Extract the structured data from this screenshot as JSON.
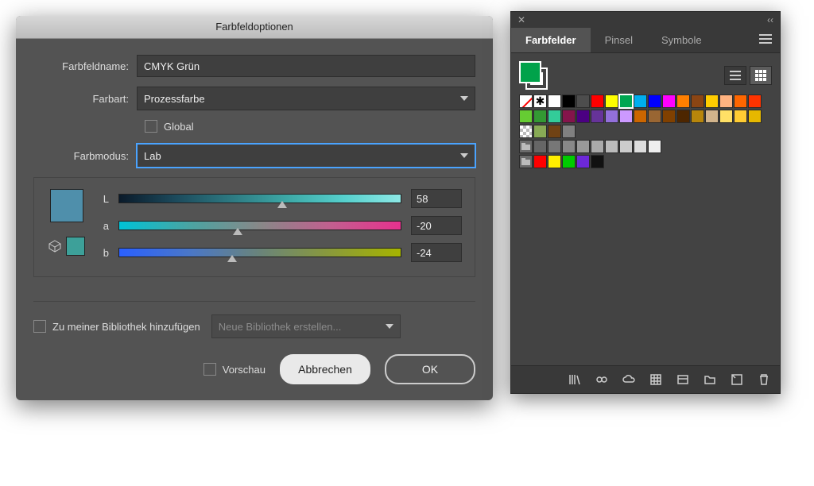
{
  "dialog": {
    "title": "Farbfeldoptionen",
    "name_label": "Farbfeldname:",
    "name_value": "CMYK Grün",
    "type_label": "Farbart:",
    "type_value": "Prozessfarbe",
    "global_label": "Global",
    "mode_label": "Farbmodus:",
    "mode_value": "Lab",
    "channels": {
      "L": {
        "label": "L",
        "value": "58",
        "thumb_pct": 58
      },
      "a": {
        "label": "a",
        "value": "-20",
        "thumb_pct": 42
      },
      "b": {
        "label": "b",
        "value": "-24",
        "thumb_pct": 40
      }
    },
    "preview_main_color": "#4f8fab",
    "preview_orig_color": "#3da099",
    "add_to_lib_label": "Zu meiner Bibliothek hinzufügen",
    "lib_select_placeholder": "Neue Bibliothek erstellen...",
    "preview_label": "Vorschau",
    "cancel_label": "Abbrechen",
    "ok_label": "OK"
  },
  "panel": {
    "tabs": [
      "Farbfelder",
      "Pinsel",
      "Symbole"
    ],
    "active_tab": 0,
    "fill_color": "#00a24a",
    "swatch_rows": [
      [
        "none",
        "reg",
        "#ffffff",
        "#000000",
        "#4d4d4d",
        "#ff0000",
        "#ffff00",
        "sel:#00a651",
        "#00aeef",
        "#0000ff",
        "#ff00ff",
        "#ff7f00",
        "#8b4513",
        "#ffcc00",
        "#ffb380",
        "#ff6600",
        "#ff3300"
      ],
      [
        "#66cc33",
        "#339933",
        "#33cc99",
        "#85144b",
        "#4b0082",
        "#663399",
        "#9370db",
        "#cc99ff",
        "#cc6600",
        "#996633",
        "#804000",
        "#4d2600",
        "#b8860b",
        "#d2b48c",
        "#ffe066",
        "#ffcc33",
        "#e6b800"
      ],
      [
        "checker",
        "pat:#88aa55",
        "pat:#704214",
        "#808080"
      ],
      [
        "folder",
        "#666666",
        "#777777",
        "#888888",
        "#999999",
        "#aaaaaa",
        "#bbbbbb",
        "#cccccc",
        "#dddddd",
        "#eeeeee"
      ],
      [
        "folder",
        "#ff0000",
        "#ffee00",
        "#00cc00",
        "#6d28d9",
        "#111111"
      ]
    ],
    "footer_icons": [
      "library-icon",
      "link-icon",
      "cloud-icon",
      "swatch-options-icon",
      "color-group-icon",
      "folder-icon",
      "new-swatch-icon",
      "trash-icon"
    ]
  }
}
